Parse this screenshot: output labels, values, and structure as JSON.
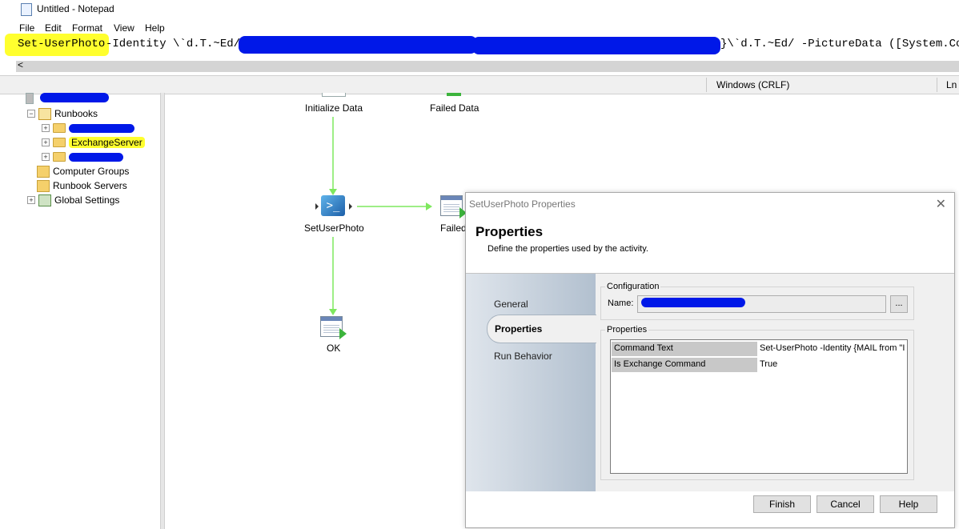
{
  "notepad": {
    "title": "Untitled - Notepad",
    "menu": [
      "File",
      "Edit",
      "Format",
      "View",
      "Help"
    ],
    "line_cmd": "Set-UserPhoto",
    "line_mid": "-Identity \\`d.T.~Ed/{",
    "line_end": "}\\`d.T.~Ed/ -PictureData ([System.Con",
    "scroll_left": "<",
    "status_encoding": "Windows (CRLF)",
    "status_ln": "Ln"
  },
  "tree": {
    "runbooks": "Runbooks",
    "exchange": "ExchangeServer",
    "computer_groups": "Computer Groups",
    "runbook_servers": "Runbook Servers",
    "global_settings": "Global Settings"
  },
  "canvas": {
    "initialize_data": "Initialize Data",
    "failed_data": "Failed Data",
    "set_user_photo": "SetUserPhoto",
    "failed": "Failed",
    "ok": "OK"
  },
  "dialog": {
    "title": "SetUserPhoto Properties",
    "heading": "Properties",
    "subtitle": "Define the properties used by the activity.",
    "nav": {
      "general": "General",
      "properties": "Properties",
      "run_behavior": "Run Behavior"
    },
    "configuration_label": "Configuration",
    "name_label": "Name:",
    "name_browse": "...",
    "properties_group": "Properties",
    "props": [
      {
        "key": "Command Text",
        "value": "Set-UserPhoto -Identity {MAIL from \"I"
      },
      {
        "key": "Is Exchange Command",
        "value": "True"
      }
    ],
    "buttons": {
      "finish": "Finish",
      "cancel": "Cancel",
      "help": "Help"
    }
  }
}
